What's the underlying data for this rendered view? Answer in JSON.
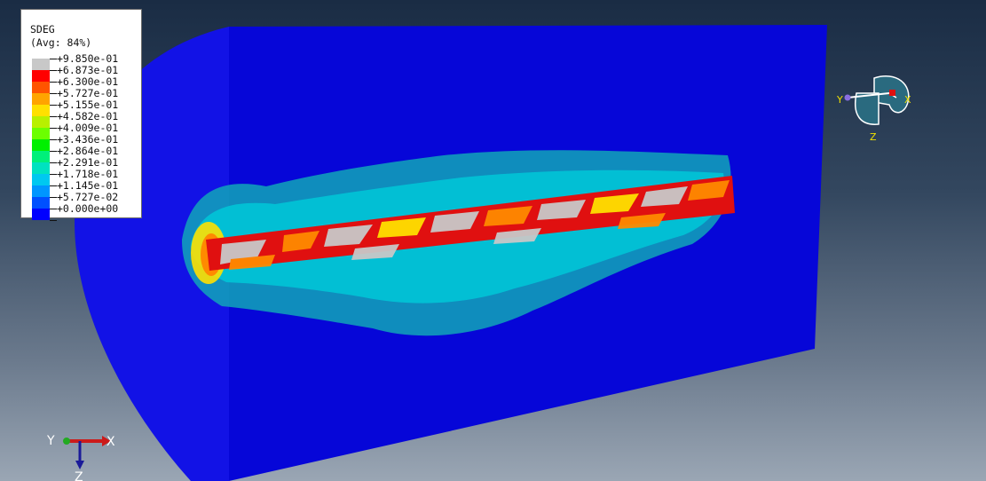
{
  "legend": {
    "title": "SDEG",
    "subtitle": "(Avg: 84%)",
    "entries": [
      {
        "color": "#c8c8c8",
        "label": "+9.850e-01"
      },
      {
        "color": "#ff0000",
        "label": "+6.873e-01"
      },
      {
        "color": "#ff5400",
        "label": "+6.300e-01"
      },
      {
        "color": "#ffa400",
        "label": "+5.727e-01"
      },
      {
        "color": "#ffe000",
        "label": "+5.155e-01"
      },
      {
        "color": "#b8f000",
        "label": "+4.582e-01"
      },
      {
        "color": "#6cff00",
        "label": "+4.009e-01"
      },
      {
        "color": "#00f000",
        "label": "+3.436e-01"
      },
      {
        "color": "#00f07a",
        "label": "+2.864e-01"
      },
      {
        "color": "#00e2c0",
        "label": "+2.291e-01"
      },
      {
        "color": "#00c8f0",
        "label": "+1.718e-01"
      },
      {
        "color": "#0096ff",
        "label": "+1.145e-01"
      },
      {
        "color": "#0050ff",
        "label": "+5.727e-02"
      },
      {
        "color": "#0000ff",
        "label": "+0.000e+00"
      }
    ]
  },
  "triad": {
    "y_label": "Y",
    "x_label": "X",
    "z_label": "Z"
  },
  "view_cube": {
    "y_label": "Y",
    "x_label": "X",
    "z_label": "Z"
  },
  "colors": {
    "model_face": "#0a0ae8",
    "model_front": "#0505e0",
    "crack_grey": "#c8c8c8",
    "crack_red": "#e01010",
    "crack_orange": "#ff8a00",
    "halo_cyan": "#00c8d8",
    "halo_teal": "#12a6b8"
  }
}
